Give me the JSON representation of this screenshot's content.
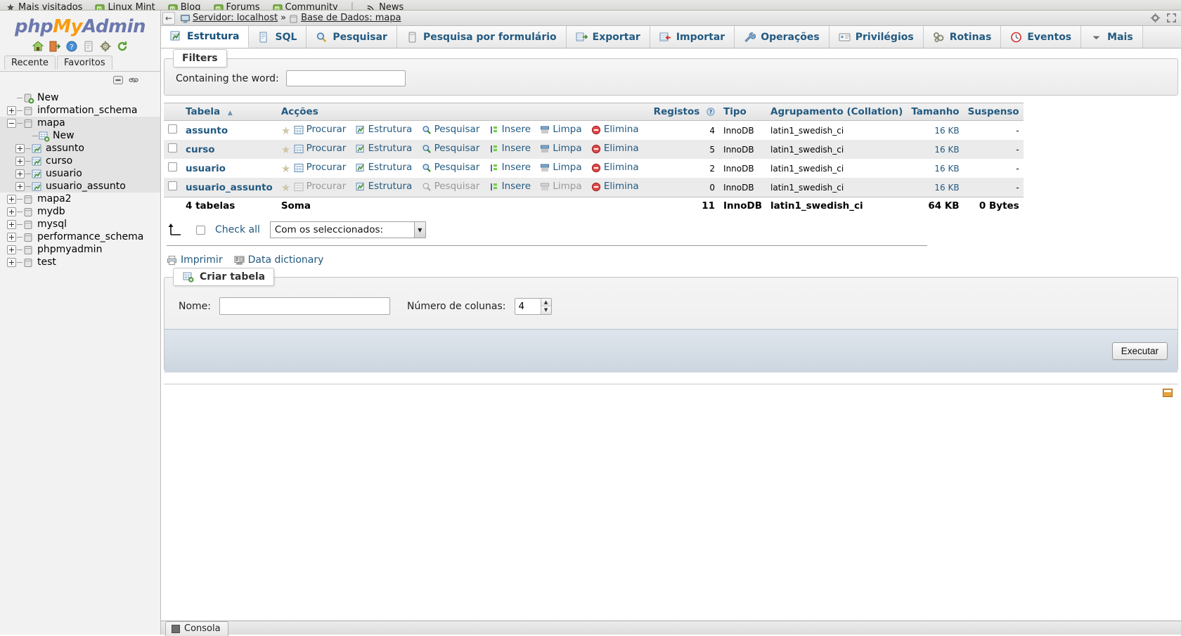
{
  "browser": {
    "bookmarks": [
      {
        "label": "Mais visitados",
        "icon": "star-icon"
      },
      {
        "label": "Linux Mint",
        "icon": "mint-icon"
      },
      {
        "label": "Blog",
        "icon": "mint-icon"
      },
      {
        "label": "Forums",
        "icon": "mint-icon"
      },
      {
        "label": "Community",
        "icon": "mint-icon"
      },
      {
        "label": "News",
        "icon": "rss-icon"
      }
    ],
    "separator": "|"
  },
  "sidebar": {
    "logo": {
      "part1": "php",
      "part2": "My",
      "part3": "Admin"
    },
    "quick_icons": [
      "home-icon",
      "logout-icon",
      "help-icon",
      "docs-icon",
      "settings-icon",
      "reload-icon"
    ],
    "tabs": [
      {
        "label": "Recente"
      },
      {
        "label": "Favoritos"
      }
    ],
    "toolbar_icons": [
      "collapse-all-icon",
      "link-with-main-panel-icon"
    ],
    "tree": [
      {
        "label": "New",
        "depth": 0,
        "expander": "none",
        "icon": "db-new-icon",
        "highlight": false
      },
      {
        "label": "information_schema",
        "depth": 0,
        "expander": "plus",
        "icon": "db-icon",
        "highlight": false
      },
      {
        "label": "mapa",
        "depth": 0,
        "expander": "minus",
        "icon": "db-icon",
        "highlight": true
      },
      {
        "label": "New",
        "depth": 1,
        "expander": "none",
        "icon": "table-new-icon",
        "highlight": true
      },
      {
        "label": "assunto",
        "depth": 1,
        "expander": "plus",
        "icon": "table-icon",
        "highlight": true
      },
      {
        "label": "curso",
        "depth": 1,
        "expander": "plus",
        "icon": "table-icon",
        "highlight": true
      },
      {
        "label": "usuario",
        "depth": 1,
        "expander": "plus",
        "icon": "table-icon",
        "highlight": true
      },
      {
        "label": "usuario_assunto",
        "depth": 1,
        "expander": "plus",
        "icon": "table-icon",
        "highlight": true
      },
      {
        "label": "mapa2",
        "depth": 0,
        "expander": "plus",
        "icon": "db-icon",
        "highlight": false
      },
      {
        "label": "mydb",
        "depth": 0,
        "expander": "plus",
        "icon": "db-icon",
        "highlight": false
      },
      {
        "label": "mysql",
        "depth": 0,
        "expander": "plus",
        "icon": "db-icon",
        "highlight": false
      },
      {
        "label": "performance_schema",
        "depth": 0,
        "expander": "plus",
        "icon": "db-icon",
        "highlight": false
      },
      {
        "label": "phpmyadmin",
        "depth": 0,
        "expander": "plus",
        "icon": "db-icon",
        "highlight": false
      },
      {
        "label": "test",
        "depth": 0,
        "expander": "plus",
        "icon": "db-icon",
        "highlight": false
      }
    ]
  },
  "breadcrumb": {
    "back_glyph": "←",
    "server_label": "Servidor: localhost",
    "separator": "»",
    "database_label": "Base de Dados: mapa",
    "right_icons": [
      "settings-icon",
      "fullscreen-icon"
    ]
  },
  "tabs": [
    {
      "label": "Estrutura",
      "icon": "structure-icon",
      "active": true
    },
    {
      "label": "SQL",
      "icon": "sql-icon",
      "active": false
    },
    {
      "label": "Pesquisar",
      "icon": "search-icon",
      "active": false
    },
    {
      "label": "Pesquisa por formulário",
      "icon": "query-form-icon",
      "active": false
    },
    {
      "label": "Exportar",
      "icon": "export-icon",
      "active": false
    },
    {
      "label": "Importar",
      "icon": "import-icon",
      "active": false
    },
    {
      "label": "Operações",
      "icon": "operations-icon",
      "active": false
    },
    {
      "label": "Privilégios",
      "icon": "privileges-icon",
      "active": false
    },
    {
      "label": "Rotinas",
      "icon": "routines-icon",
      "active": false
    },
    {
      "label": "Eventos",
      "icon": "events-icon",
      "active": false
    },
    {
      "label": "Mais",
      "icon": "chevron-down-icon",
      "active": false
    }
  ],
  "filters": {
    "legend": "Filters",
    "containing_label": "Containing the word:",
    "containing_value": "",
    "containing_placeholder": ""
  },
  "table": {
    "columns": [
      "",
      "Tabela",
      "Acções",
      "Registos",
      "Tipo",
      "Agrupamento (Collation)",
      "Tamanho",
      "Suspenso"
    ],
    "sort_indicator": "▲",
    "registos_help_icon": "question-mark-icon",
    "action_labels": [
      "Procurar",
      "Estrutura",
      "Pesquisar",
      "Insere",
      "Limpa",
      "Elimina"
    ],
    "rows": [
      {
        "name": "assunto",
        "actions": [
          "Procurar",
          "Estrutura",
          "Pesquisar",
          "Insere",
          "Limpa",
          "Elimina"
        ],
        "dimmed": false,
        "registos": "4",
        "tipo": "InnoDB",
        "collation": "latin1_swedish_ci",
        "tamanho": "16 KB",
        "suspenso": "-"
      },
      {
        "name": "curso",
        "actions": [
          "Procurar",
          "Estrutura",
          "Pesquisar",
          "Insere",
          "Limpa",
          "Elimina"
        ],
        "dimmed": false,
        "registos": "5",
        "tipo": "InnoDB",
        "collation": "latin1_swedish_ci",
        "tamanho": "16 KB",
        "suspenso": "-"
      },
      {
        "name": "usuario",
        "actions": [
          "Procurar",
          "Estrutura",
          "Pesquisar",
          "Insere",
          "Limpa",
          "Elimina"
        ],
        "dimmed": false,
        "registos": "2",
        "tipo": "InnoDB",
        "collation": "latin1_swedish_ci",
        "tamanho": "16 KB",
        "suspenso": "-"
      },
      {
        "name": "usuario_assunto",
        "actions": [
          "Procurar",
          "Estrutura",
          "Pesquisar",
          "Insere",
          "Limpa",
          "Elimina"
        ],
        "dimmed": true,
        "registos": "0",
        "tipo": "InnoDB",
        "collation": "latin1_swedish_ci",
        "tamanho": "16 KB",
        "suspenso": "-"
      }
    ],
    "summary": {
      "count_label": "4 tabelas",
      "soma_label": "Soma",
      "registos": "11",
      "tipo": "InnoDB",
      "collation": "latin1_swedish_ci",
      "tamanho": "64 KB",
      "suspenso": "0 Bytes"
    }
  },
  "with_selected": {
    "check_all_label": "Check all",
    "select_value": "Com os seleccionados:",
    "select_options": [
      "Com os seleccionados:"
    ]
  },
  "bottom_links": [
    {
      "label": "Imprimir",
      "icon": "print-icon"
    },
    {
      "label": "Data dictionary",
      "icon": "dictionary-icon"
    }
  ],
  "create_table": {
    "legend": "Criar tabela",
    "legend_icon": "table-new-icon",
    "name_label": "Nome:",
    "name_value": "",
    "columns_label": "Número de colunas:",
    "columns_value": "4",
    "submit_label": "Executar"
  },
  "console": {
    "label": "Consola",
    "icon": "console-icon"
  },
  "colors": {
    "link": "#235a81",
    "accent_orange": "#f89c0e",
    "accent_purple": "#6c78af",
    "row_even": "#ebebeb",
    "footer_blue": "#ccd6e0"
  }
}
